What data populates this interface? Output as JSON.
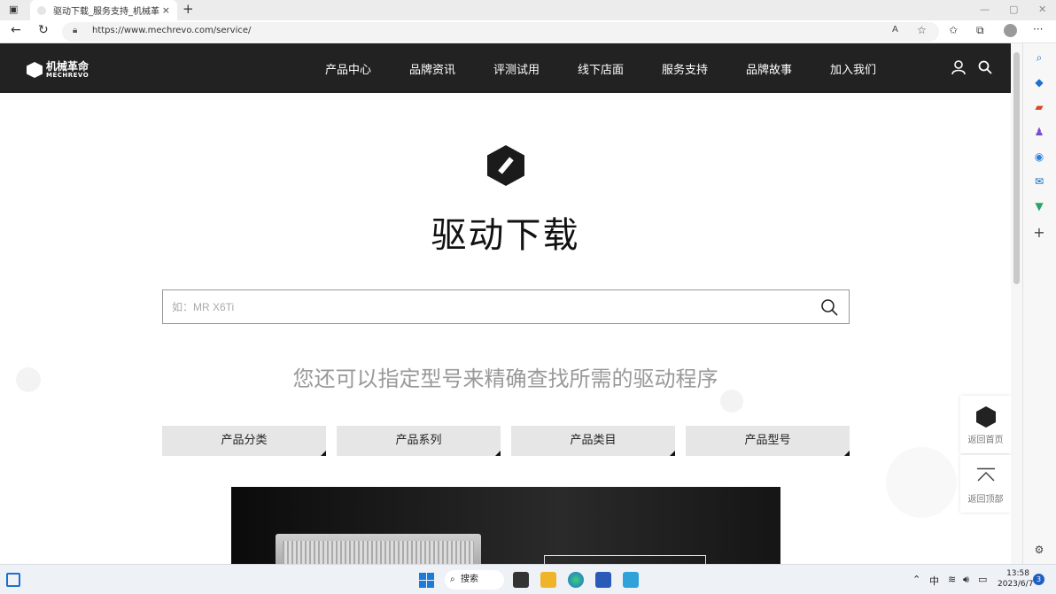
{
  "browser": {
    "tab_title": "驱动下载_服务支持_机械革命官方",
    "tab_close": "×",
    "new_tab": "+",
    "url": "https://www.mechrevo.com/service/",
    "controls": {
      "minimize": "—",
      "maximize": "▢",
      "close": "✕"
    }
  },
  "header": {
    "logo_cn": "机械革命",
    "logo_en": "MECHREVO",
    "nav": [
      {
        "label": "产品中心"
      },
      {
        "label": "品牌资讯"
      },
      {
        "label": "评测试用"
      },
      {
        "label": "线下店面"
      },
      {
        "label": "服务支持"
      },
      {
        "label": "品牌故事"
      },
      {
        "label": "加入我们"
      }
    ]
  },
  "main": {
    "title": "驱动下载",
    "search_placeholder": "如：MR X6Ti",
    "subtitle": "您还可以指定型号来精确查找所需的驱动程序",
    "filters": [
      {
        "label": "产品分类"
      },
      {
        "label": "产品系列"
      },
      {
        "label": "产品类目"
      },
      {
        "label": "产品型号"
      }
    ]
  },
  "side": {
    "home_label": "返回首页",
    "top_label": "返回顶部"
  },
  "taskbar": {
    "search_label": "搜索",
    "ime": "中",
    "time": "13:58",
    "date": "2023/6/7",
    "badge": "3"
  },
  "colors": {
    "header_bg": "#222222",
    "accent_dark": "#1b1b1b",
    "filter_bg": "#e6e6e6"
  }
}
